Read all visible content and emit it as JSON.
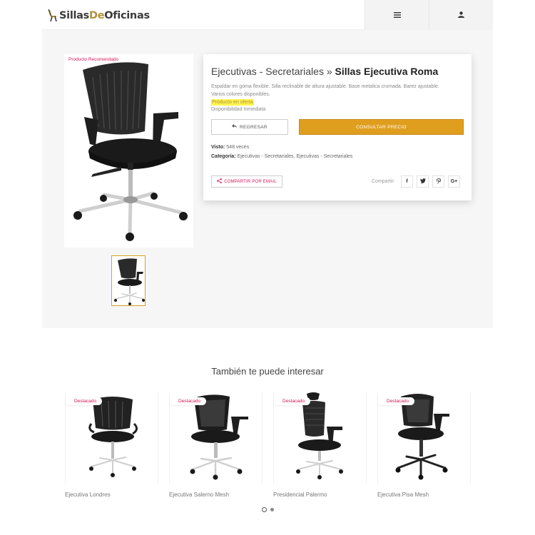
{
  "header": {
    "logo": {
      "part1": "Sillas",
      "part2": "De",
      "part3": "Oficinas"
    },
    "menu_icon": "hamburger-menu-icon",
    "user_icon": "user-icon"
  },
  "product": {
    "badge": "Producto Recomendado",
    "category": "Ejecutivas - Secretariales",
    "separator": " » ",
    "name": "Sillas Ejecutiva Roma",
    "description": "Espaldar en goma flexible. Silla reclinable de altura ajustable. Base metalica cromada. Barez ajustable. Varios colores disponibles.",
    "offer": "Producto en oferta",
    "availability": "Disponibilidad Inmediata",
    "back_label": "REGRESAR",
    "price_label": "CONSULTAR PRECIO",
    "views_label": "Visto:",
    "views_value": "548 veces",
    "category_label": "Categoría:",
    "category_value": "Ejecutivas - Secretariales, Ejecutivas - Secretariales",
    "share_email_label": "COMPARTIR POR EMAIL",
    "share_label": "Compartir:",
    "social": [
      "f",
      "t",
      "p",
      "G+"
    ]
  },
  "related": {
    "title": "También te puede interesar",
    "items": [
      {
        "badge": "Destacado",
        "name": "Ejecutiva Londres"
      },
      {
        "badge": "Destacado",
        "name": "Ejecutiva Salerno Mesh"
      },
      {
        "badge": "Destacado",
        "name": "Presidencial Palermo"
      },
      {
        "badge": "Destacado",
        "name": "Ejecutiva Pisa Mesh"
      }
    ]
  },
  "colors": {
    "accent_gold": "#e09e1e",
    "badge_pink": "#d4145a",
    "thumb_border": "#d6a21e"
  }
}
